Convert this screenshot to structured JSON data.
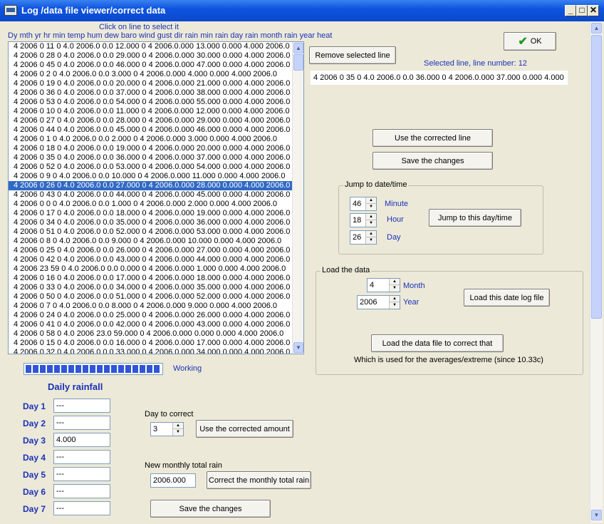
{
  "window": {
    "title": "Log /data file viewer/correct data",
    "controls": {
      "minimize": "_",
      "maximize": "□",
      "close": "✕"
    }
  },
  "log": {
    "click_hint": "Click on line to select it",
    "columns_header": "Dy mth yr hr min temp hum dew baro wind gust dir rain min rain day rain month rain year heat",
    "selected_index": 15,
    "lines": [
      "4 2006  0 11  0 4.0 2006.0 0.0 12.000  0  4 2006.0.000 13.000 0.000 4.000 2006.0",
      "4 2006  0 28  0 4.0 2006.0 0.0 29.000  0  4 2006.0.000 30.000 0.000 4.000 2006.0",
      "4 2006  0 45  0 4.0 2006.0 0.0 46.000  0  4 2006.0.000 47.000 0.000 4.000 2006.0",
      "4 2006  0  2  0 4.0 2006.0 0.0 3.000  0  4 2006.0.000 4.000 0.000 4.000 2006.0",
      "4 2006  0 19  0 4.0 2006.0 0.0 20.000  0  4 2006.0.000 21.000 0.000 4.000 2006.0",
      "4 2006  0 36  0 4.0 2006.0 0.0 37.000  0  4 2006.0.000 38.000 0.000 4.000 2006.0",
      "4 2006  0 53  0 4.0 2006.0 0.0 54.000  0  4 2006.0.000 55.000 0.000 4.000 2006.0",
      "4 2006  0 10  0 4.0 2006.0 0.0 11.000  0  4 2006.0.000 12.000 0.000 4.000 2006.0",
      "4 2006  0 27  0 4.0 2006.0 0.0 28.000  0  4 2006.0.000 29.000 0.000 4.000 2006.0",
      "4 2006  0 44  0 4.0 2006.0 0.0 45.000  0  4 2006.0.000 46.000 0.000 4.000 2006.0",
      "4 2006  0  1  0 4.0 2006.0 0.0 2.000  0  4 2006.0.000 3.000 0.000 4.000 2006.0",
      "4 2006  0 18  0 4.0 2006.0 0.0 19.000  0  4 2006.0.000 20.000 0.000 4.000 2006.0",
      "4 2006  0 35  0 4.0 2006.0 0.0 36.000  0  4 2006.0.000 37.000 0.000 4.000 2006.0",
      "4 2006  0 52  0 4.0 2006.0 0.0 53.000  0  4 2006.0.000 54.000 0.000 4.000 2006.0",
      "4 2006  0  9  0 4.0 2006.0 0.0 10.000  0  4 2006.0.000 11.000 0.000 4.000 2006.0",
      "4 2006  0 26  0 4.0 2006.0 0.0 27.000  0  4 2006.0.000 28.000 0.000 4.000 2006.0",
      "4 2006  0 43  0 4.0 2006.0 0.0 44.000  0  4 2006.0.000 45.000 0.000 4.000 2006.0",
      "4 2006  0  0  0 4.0 2006.0 0.0 1.000  0  4 2006.0.000 2.000 0.000 4.000 2006.0",
      "4 2006  0 17  0 4.0 2006.0 0.0 18.000  0  4 2006.0.000 19.000 0.000 4.000 2006.0",
      "4 2006  0 34  0 4.0 2006.0 0.0 35.000  0  4 2006.0.000 36.000 0.000 4.000 2006.0",
      "4 2006  0 51  0 4.0 2006.0 0.0 52.000  0  4 2006.0.000 53.000 0.000 4.000 2006.0",
      "4 2006  0  8  0 4.0 2006.0 0.0 9.000  0  4 2006.0.000 10.000 0.000 4.000 2006.0",
      "4 2006  0 25  0 4.0 2006.0 0.0 26.000  0  4 2006.0.000 27.000 0.000 4.000 2006.0",
      "4 2006  0 42  0 4.0 2006.0 0.0 43.000  0  4 2006.0.000 44.000 0.000 4.000 2006.0",
      "4 2006 23 59  0 4.0 2006.0 0.0 0.000  0  4 2006.0.000 1.000 0.000 4.000 2006.0",
      "4 2006  0 16  0 4.0 2006.0 0.0 17.000  0  4 2006.0.000 18.000 0.000 4.000 2006.0",
      "4 2006  0 33  0 4.0 2006.0 0.0 34.000  0  4 2006.0.000 35.000 0.000 4.000 2006.0",
      "4 2006  0 50  0 4.0 2006.0 0.0 51.000  0  4 2006.0.000 52.000 0.000 4.000 2006.0",
      "4 2006  0  7  0 4.0 2006.0 0.0 8.000  0  4 2006.0.000 9.000 0.000 4.000 2006.0",
      "4 2006  0 24  0 4.0 2006.0 0.0 25.000  0  4 2006.0.000 26.000 0.000 4.000 2006.0",
      "4 2006  0 41  0 4.0 2006.0 0.0 42.000  0  4 2006.0.000 43.000 0.000 4.000 2006.0",
      "4 2006  0 58  0 4.0 2006 23.0 59.000  0  4 2006.0.000 0.000 0.000 4.000 2006.0",
      "4 2006  0 15  0 4.0 2006.0 0.0 16.000  0  4 2006.0.000 17.000 0.000 4.000 2006.0",
      "4 2006  0 32  0 4.0 2006.0 0.0 33.000  0  4 2006.0.000 34.000 0.000 4.000 2006.0"
    ]
  },
  "status": {
    "working_label": "Working"
  },
  "edit": {
    "remove_button": "Remove selected line",
    "selected_caption": "Selected line, line number: 12",
    "selected_value": "4 2006  0 35  0 4.0 2006.0 0.0 36.000  0  4 2006.0.000 37.000 0.000 4.000",
    "ok_button": "OK",
    "use_corrected_button": "Use the corrected line",
    "save_button": "Save the changes"
  },
  "jump": {
    "group_title": "Jump to date/time",
    "minute_value": "46",
    "minute_label": "Minute",
    "hour_value": "18",
    "hour_label": "Hour",
    "day_value": "26",
    "day_label": "Day",
    "button": "Jump to this day/time"
  },
  "load": {
    "group_title": "Load the data",
    "month_value": "4",
    "month_label": "Month",
    "year_value": "2006",
    "year_label": "Year",
    "load_date_button": "Load this date log file",
    "load_correct_button": "Load the data file to correct that",
    "note": "Which is used for the averages/extreme (since 10.33c)"
  },
  "rainfall": {
    "title": "Daily rainfall",
    "days": [
      {
        "label": "Day 1",
        "value": "---"
      },
      {
        "label": "Day 2",
        "value": "---"
      },
      {
        "label": "Day 3",
        "value": "4.000"
      },
      {
        "label": "Day 4",
        "value": "---"
      },
      {
        "label": "Day 5",
        "value": "---"
      },
      {
        "label": "Day 6",
        "value": "---"
      },
      {
        "label": "Day 7",
        "value": "---"
      }
    ],
    "day_to_correct_label": "Day to correct",
    "day_to_correct_value": "3",
    "use_corrected_amount_button": "Use the corrected amount",
    "monthly_total_label": "New monthly total rain",
    "monthly_total_value": "2006.000",
    "correct_monthly_button": "Correct the monthly total rain",
    "save_button": "Save the changes"
  },
  "colors": {
    "selection": "#316ac5",
    "accent_text": "#1a32b8",
    "titlebar": "#0e54e0"
  }
}
